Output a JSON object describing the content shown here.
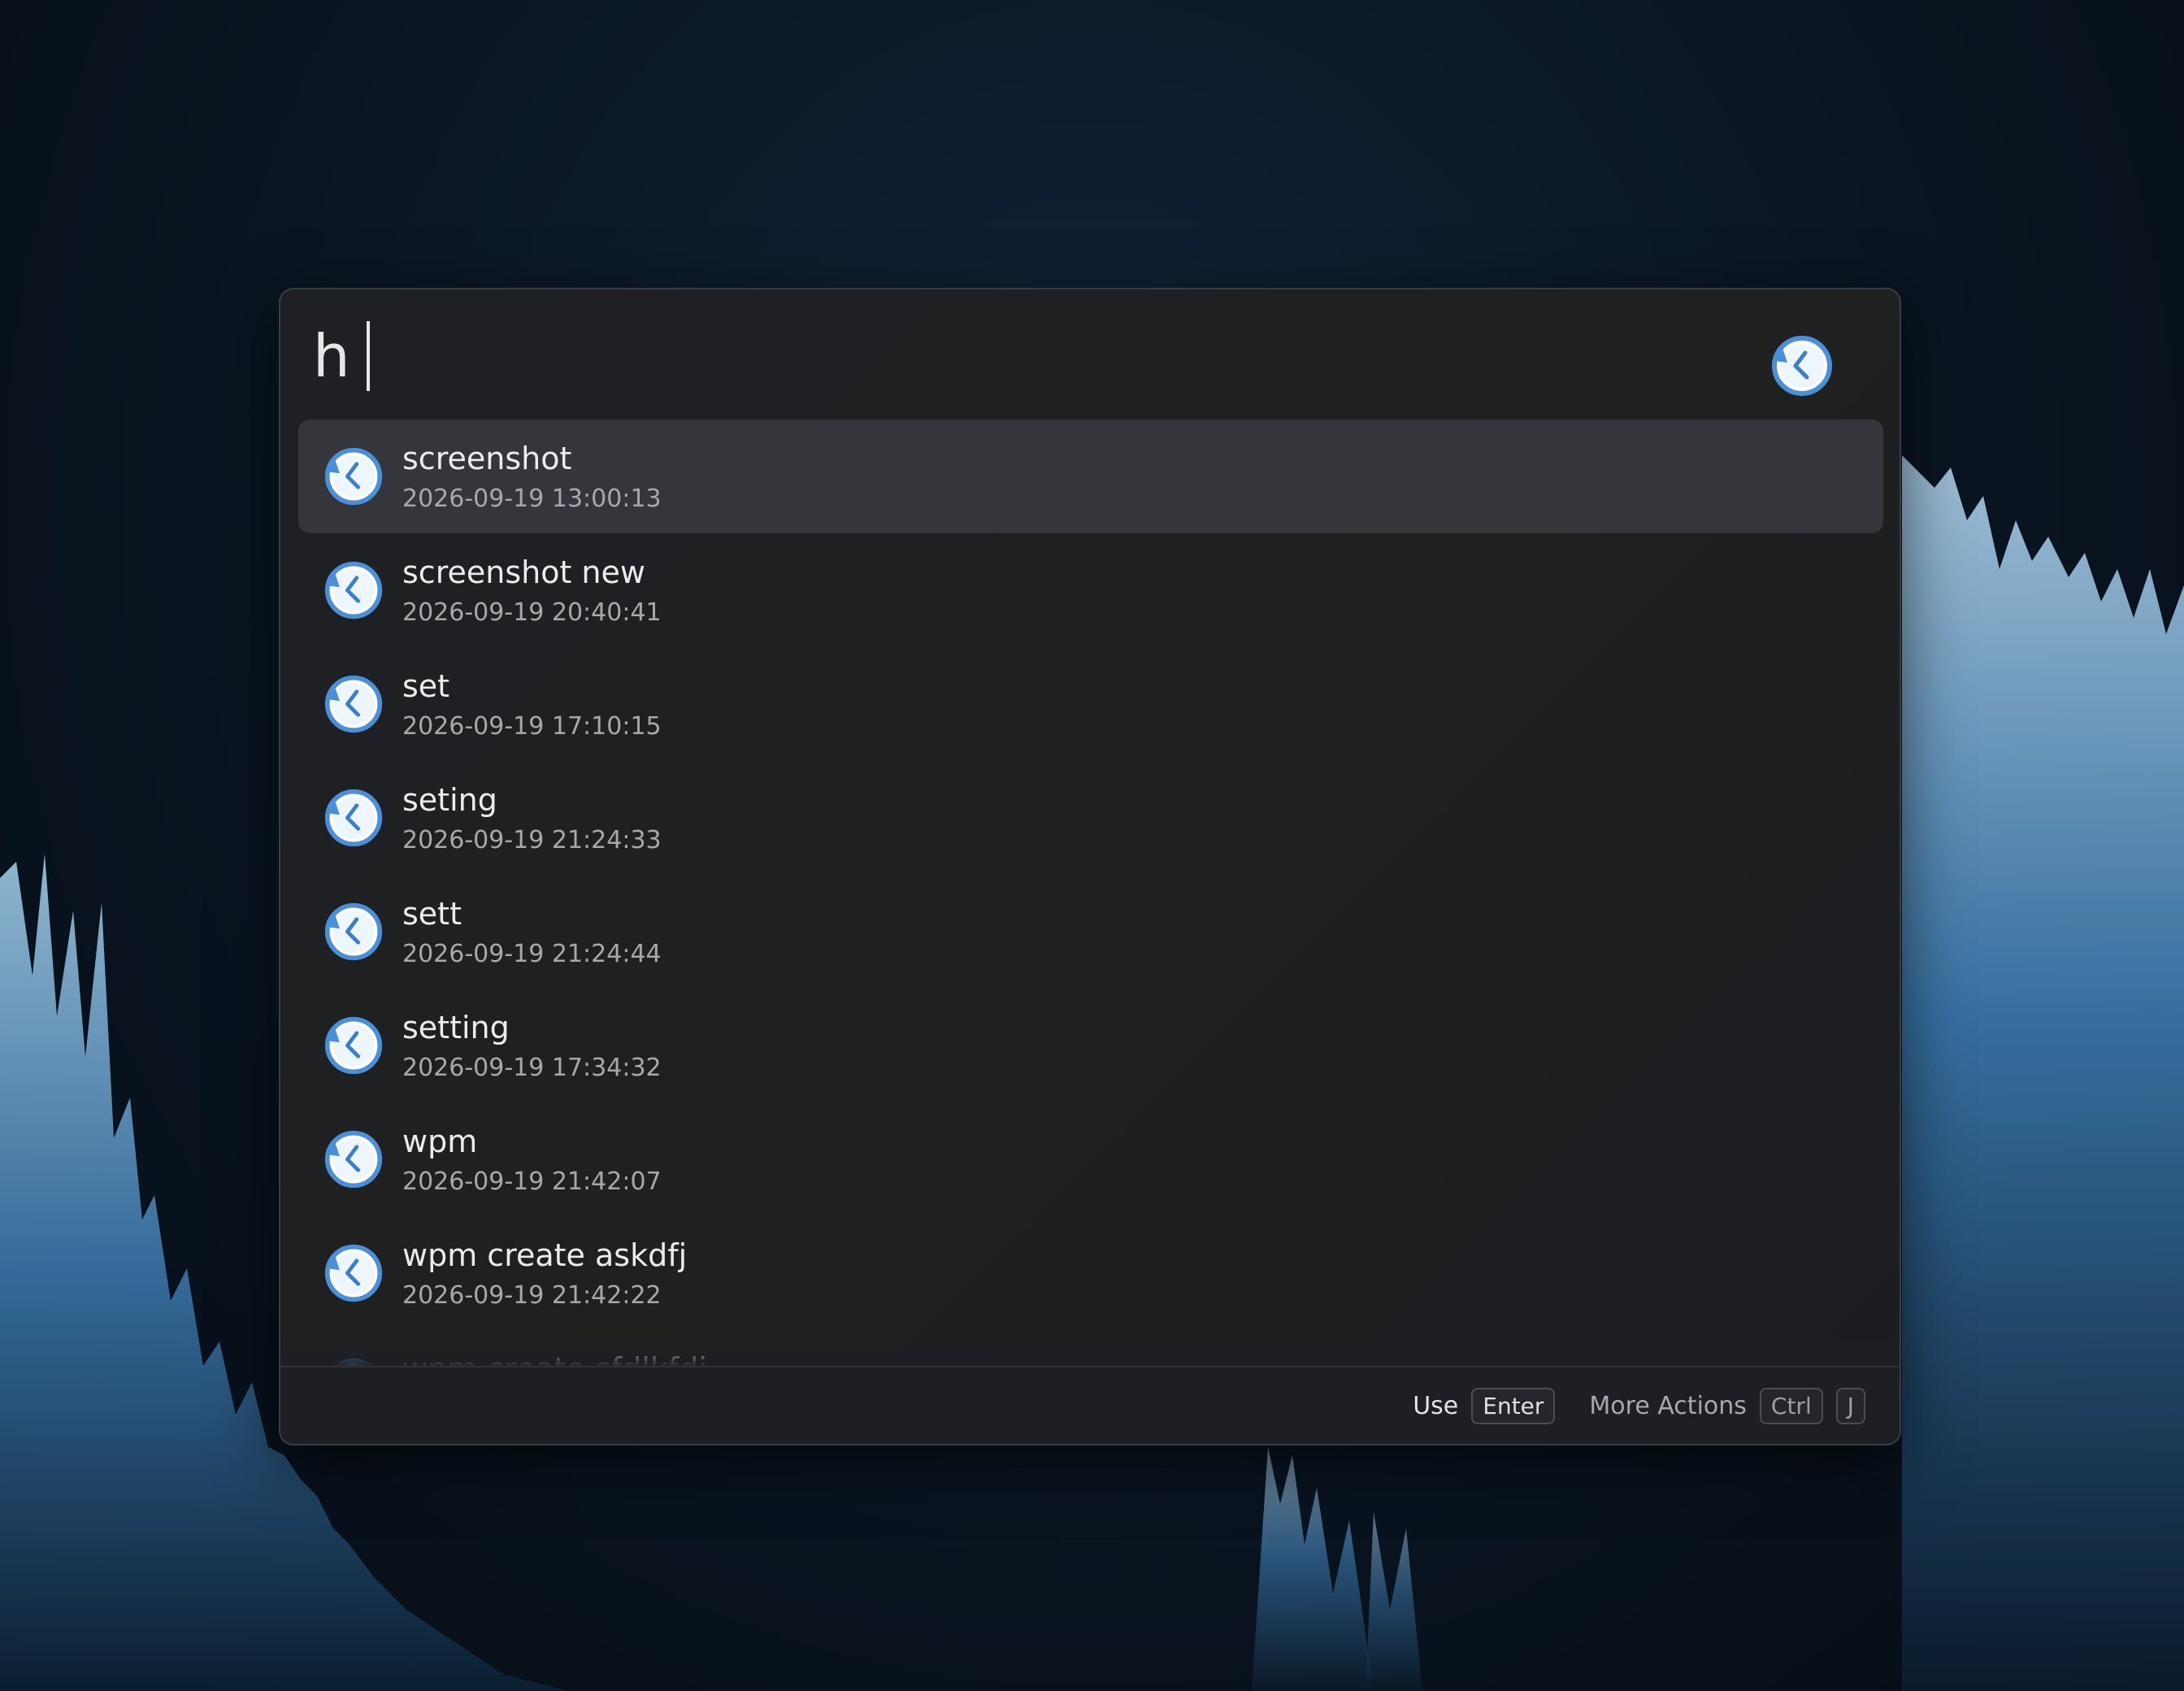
{
  "search": {
    "query": "h"
  },
  "results": [
    {
      "title": "screenshot",
      "subtitle": "2026-09-19 13:00:13",
      "selected": true
    },
    {
      "title": "screenshot new",
      "subtitle": "2026-09-19 20:40:41"
    },
    {
      "title": "set",
      "subtitle": "2026-09-19 17:10:15"
    },
    {
      "title": "seting",
      "subtitle": "2026-09-19 21:24:33"
    },
    {
      "title": "sett",
      "subtitle": "2026-09-19 21:24:44"
    },
    {
      "title": "setting",
      "subtitle": "2026-09-19 17:34:32"
    },
    {
      "title": "wpm",
      "subtitle": "2026-09-19 21:42:07"
    },
    {
      "title": "wpm create askdfj",
      "subtitle": "2026-09-19 21:42:22"
    },
    {
      "title": "wpm create sfdlkfdj",
      "subtitle": ""
    }
  ],
  "footer": {
    "use_label": "Use",
    "enter_key": "Enter",
    "more_actions_label": "More Actions",
    "ctrl_key": "Ctrl",
    "j_key": "J"
  },
  "icons": {
    "result_icon": "history-clock-icon",
    "plugin_icon": "history-clock-icon"
  },
  "colors": {
    "accent_blue": "#4a90d9",
    "selected_row": "#34363c",
    "panel_bg": "#1e2026"
  }
}
